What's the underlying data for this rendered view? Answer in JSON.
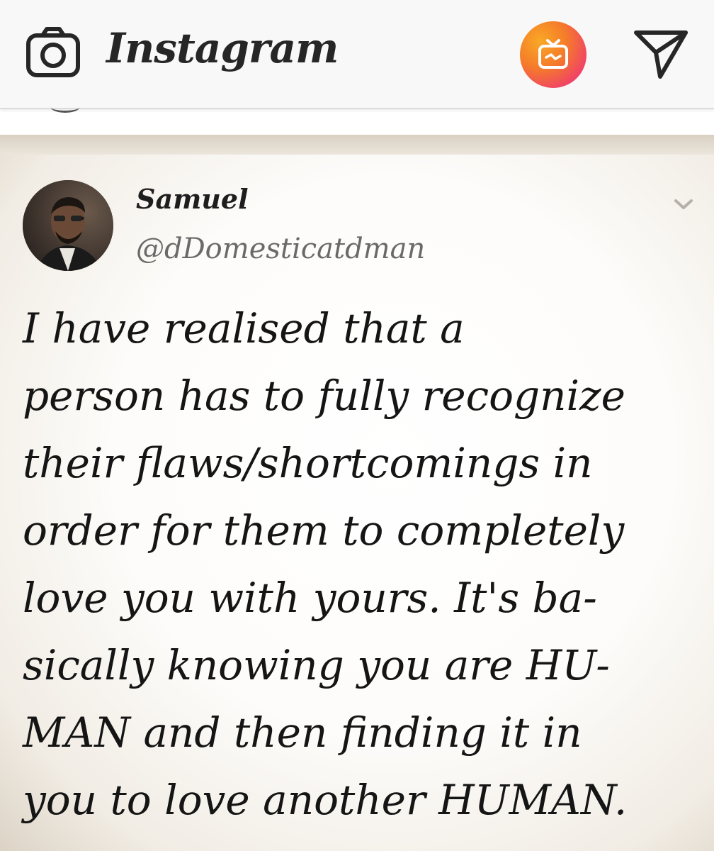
{
  "app": {
    "name": "Instagram",
    "icons": {
      "camera": "camera-icon",
      "igtv": "igtv-icon",
      "direct": "direct-message-icon"
    },
    "colors": {
      "igtv_gradient_start": "#f9a825",
      "igtv_gradient_end": "#ef2f7a"
    }
  },
  "post": {
    "author": {
      "name": "Samuel",
      "handle": "@dDomesticatdman"
    },
    "text_lines": [
      "I have realised that a",
      "person has to fully recognize",
      "their flaws/shortcomings in",
      "order for them to completely",
      "love you with yours. It's ba-",
      "sically knowing you are HU-",
      "MAN and then finding it in",
      "you to love another HUMAN."
    ]
  }
}
